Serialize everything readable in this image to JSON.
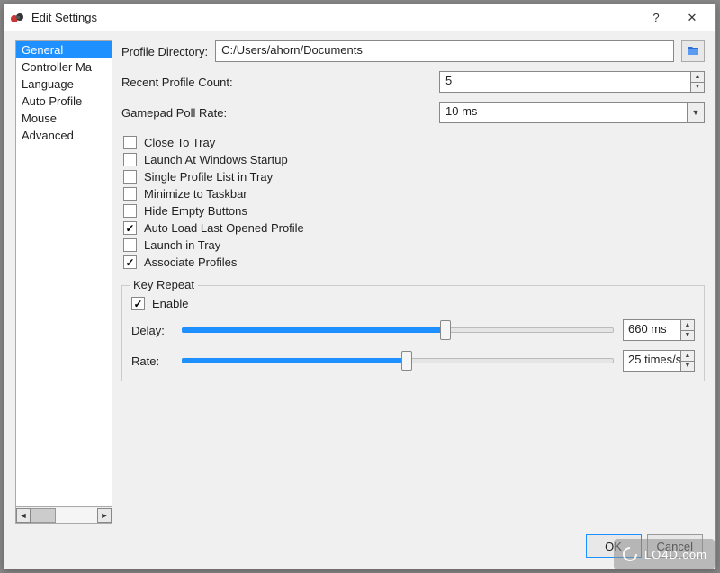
{
  "window": {
    "title": "Edit Settings",
    "help_tooltip": "?",
    "close_tooltip": "✕"
  },
  "sidebar": {
    "items": [
      {
        "label": "General",
        "selected": true
      },
      {
        "label": "Controller Ma"
      },
      {
        "label": "Language"
      },
      {
        "label": "Auto Profile"
      },
      {
        "label": "Mouse"
      },
      {
        "label": "Advanced"
      }
    ]
  },
  "general": {
    "profile_directory_label": "Profile Directory:",
    "profile_directory_value": "C:/Users/ahorn/Documents",
    "recent_profile_count_label": "Recent Profile Count:",
    "recent_profile_count_value": "5",
    "gamepad_poll_rate_label": "Gamepad Poll Rate:",
    "gamepad_poll_rate_value": "10 ms",
    "checkboxes": [
      {
        "label": "Close To Tray",
        "checked": false
      },
      {
        "label": "Launch At Windows Startup",
        "checked": false
      },
      {
        "label": "Single Profile List in Tray",
        "checked": false
      },
      {
        "label": "Minimize to Taskbar",
        "checked": false
      },
      {
        "label": "Hide Empty Buttons",
        "checked": false
      },
      {
        "label": "Auto Load Last Opened Profile",
        "checked": true
      },
      {
        "label": "Launch in Tray",
        "checked": false
      },
      {
        "label": "Associate Profiles",
        "checked": true
      }
    ],
    "key_repeat": {
      "title": "Key Repeat",
      "enable_label": "Enable",
      "enable_checked": true,
      "delay_label": "Delay:",
      "delay_value": "660 ms",
      "delay_fill_pct": 61,
      "rate_label": "Rate:",
      "rate_value": "25 times/s",
      "rate_fill_pct": 52
    }
  },
  "footer": {
    "ok_label": "OK",
    "cancel_label": "Cancel"
  },
  "watermark": "LO4D.com"
}
